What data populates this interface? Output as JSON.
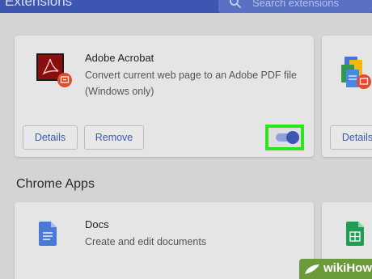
{
  "header": {
    "title": "Extensions",
    "search_placeholder": "Search extensions",
    "search_icon": "search-icon"
  },
  "extensions": [
    {
      "name": "Adobe Acrobat",
      "description": "Convert current web page to an Adobe PDF file (Windows only)",
      "details_label": "Details",
      "remove_label": "Remove",
      "enabled": true,
      "icon": "adobe-acrobat-icon"
    },
    {
      "details_label": "Details",
      "icon": "google-docs-suite-icon"
    }
  ],
  "chrome_apps": {
    "heading": "Chrome Apps",
    "apps": [
      {
        "name": "Docs",
        "description": "Create and edit documents",
        "icon": "google-docs-icon"
      },
      {
        "icon": "google-sheets-icon"
      }
    ]
  },
  "watermark": {
    "text": "wikiHow"
  },
  "colors": {
    "accent": "#3d56b2",
    "highlight": "#2ee51b",
    "background": "#d4d4d4",
    "card": "#e5e5e5"
  }
}
